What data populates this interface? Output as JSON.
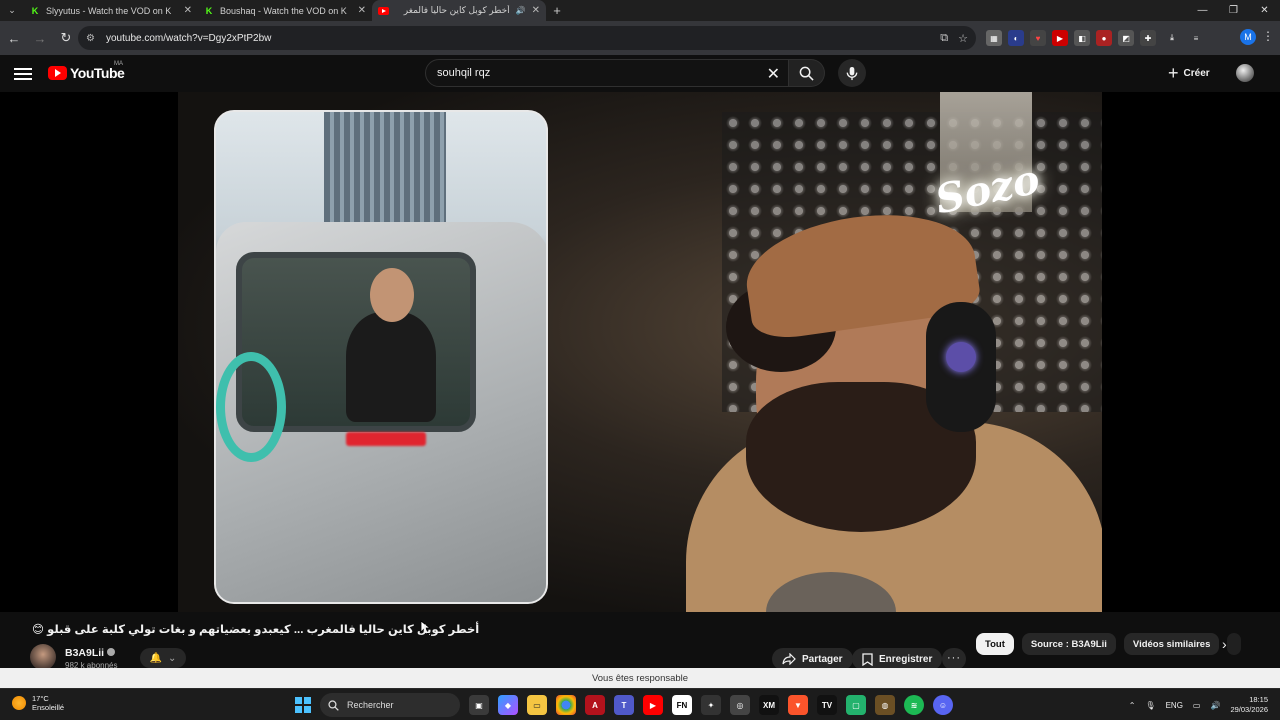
{
  "browser": {
    "tabs": [
      {
        "label": "Slyyutus - Watch the VOD on K",
        "favicon": "kick-icon",
        "active": false
      },
      {
        "label": "Boushaq - Watch the VOD on K",
        "favicon": "kick-icon",
        "active": false
      },
      {
        "label": "أخطر كوبل كاين حاليا فالمغر",
        "favicon": "youtube-icon",
        "active": true
      }
    ],
    "url": "youtube.com/watch?v=Dgy2xPtP2bw",
    "profile_initial": "M"
  },
  "youtube": {
    "logo_text": "YouTube",
    "country_code": "MA",
    "search_value": "souhqil rqz",
    "create_label": "Créer"
  },
  "video": {
    "title": "أخطر كوبل كاين حاليا فالمغرب ... كيعبدو بعضياتهم و بغات تولي كلبة على قبلو 😊",
    "channel_name": "B3A9Lii",
    "subscribers": "982 k abonnés",
    "share_label": "Partager",
    "save_label": "Enregistrer",
    "neon_text": "Sozo"
  },
  "chips": [
    {
      "label": "Tout",
      "selected": true
    },
    {
      "label": "Source : B3A9Lii",
      "selected": false
    },
    {
      "label": "Vidéos similaires",
      "selected": false
    }
  ],
  "infobar": {
    "text": "Vous êtes responsable"
  },
  "taskbar": {
    "temperature": "17°C",
    "weather": "Ensoleillé",
    "search_label": "Rechercher",
    "language": "ENG",
    "time": "18:15",
    "date": "29/03/2026"
  },
  "colors": {
    "youtube_red": "#ff0000",
    "kick_green": "#53fc18",
    "accent_blue": "#1a73e8"
  }
}
